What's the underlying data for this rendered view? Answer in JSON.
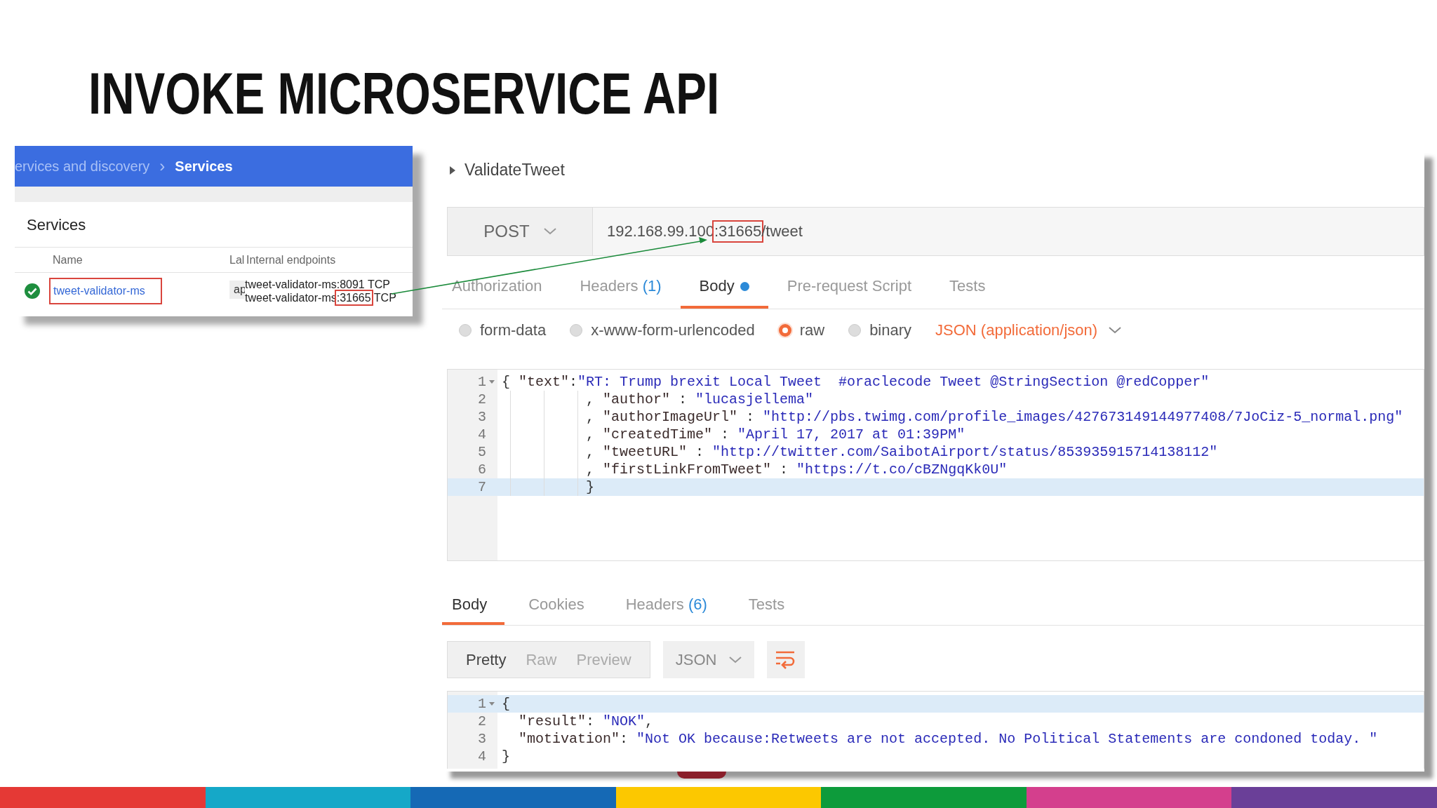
{
  "slide_title": "INVOKE MICROSERVICE API",
  "services_panel": {
    "breadcrumb": [
      {
        "label": "ervices and discovery",
        "current": false
      },
      {
        "label": "Services",
        "current": true
      }
    ],
    "separator": "›",
    "title": "Services",
    "columns": [
      {
        "label": "Name"
      },
      {
        "label": "Lal"
      },
      {
        "label": "Internal endpoints"
      }
    ],
    "rows": [
      {
        "healthy": true,
        "name": "tweet-validator-ms",
        "name_highlighted": true,
        "label_chip": "ap",
        "endpoints": [
          [
            {
              "text": "tweet-validator-ms:8091 TCP",
              "highlighted": false
            }
          ],
          [
            {
              "text": "tweet-validator-ms",
              "highlighted": false
            },
            {
              "text": ":31665",
              "highlighted": true
            },
            {
              "text": " TCP",
              "highlighted": false
            }
          ]
        ]
      }
    ]
  },
  "request": {
    "name": "ValidateTweet",
    "method": "POST",
    "url": [
      {
        "text": "192.168.99.100",
        "highlighted": false
      },
      {
        "text": ":31665",
        "highlighted": true
      },
      {
        "text": "/tweet",
        "highlighted": false
      }
    ],
    "tabs": [
      {
        "label": "Authorization",
        "dot": false,
        "selected": false
      },
      {
        "label": "Headers",
        "count": "(1)",
        "dot": false,
        "selected": false
      },
      {
        "label": "Body",
        "dot": true,
        "selected": true
      },
      {
        "label": "Pre-request Script",
        "dot": false,
        "selected": false
      },
      {
        "label": "Tests",
        "dot": false,
        "selected": false
      }
    ],
    "body_types": [
      {
        "kind": "radio",
        "label": "form-data",
        "selected": false
      },
      {
        "kind": "radio",
        "label": "x-www-form-urlencoded",
        "selected": false
      },
      {
        "kind": "radio",
        "label": "raw",
        "selected": true
      },
      {
        "kind": "radio",
        "label": "binary",
        "selected": false
      },
      {
        "kind": "dropdown",
        "label": "JSON (application/json)"
      }
    ],
    "code": [
      {
        "number": "1",
        "foldable": true,
        "kind": "top",
        "current": false,
        "tokens": [
          {
            "kind": "punct",
            "text": "{ "
          },
          {
            "kind": "key",
            "text": "\"text\""
          },
          {
            "kind": "punct",
            "text": ":"
          },
          {
            "kind": "string",
            "text": "\"RT: Trump brexit Local Tweet  #oraclecode Tweet @StringSection @redCopper\""
          }
        ]
      },
      {
        "number": "2",
        "foldable": false,
        "kind": "continuation",
        "current": false,
        "tokens": [
          {
            "kind": "punct",
            "text": ", "
          },
          {
            "kind": "key",
            "text": "\"author\""
          },
          {
            "kind": "punct",
            "text": " : "
          },
          {
            "kind": "string",
            "text": "\"lucasjellema\""
          }
        ]
      },
      {
        "number": "3",
        "foldable": false,
        "kind": "continuation",
        "current": false,
        "tokens": [
          {
            "kind": "punct",
            "text": ", "
          },
          {
            "kind": "key",
            "text": "\"authorImageUrl\""
          },
          {
            "kind": "punct",
            "text": " : "
          },
          {
            "kind": "string",
            "text": "\"http://pbs.twimg.com/profile_images/427673149144977408/7JoCiz-5_normal.png\""
          }
        ]
      },
      {
        "number": "4",
        "foldable": false,
        "kind": "continuation",
        "current": false,
        "tokens": [
          {
            "kind": "punct",
            "text": ", "
          },
          {
            "kind": "key",
            "text": "\"createdTime\""
          },
          {
            "kind": "punct",
            "text": " : "
          },
          {
            "kind": "string",
            "text": "\"April 17, 2017 at 01:39PM\""
          }
        ]
      },
      {
        "number": "5",
        "foldable": false,
        "kind": "continuation",
        "current": false,
        "tokens": [
          {
            "kind": "punct",
            "text": ", "
          },
          {
            "kind": "key",
            "text": "\"tweetURL\""
          },
          {
            "kind": "punct",
            "text": " : "
          },
          {
            "kind": "string",
            "text": "\"http://twitter.com/SaibotAirport/status/853935915714138112\""
          }
        ]
      },
      {
        "number": "6",
        "foldable": false,
        "kind": "continuation",
        "current": false,
        "tokens": [
          {
            "kind": "punct",
            "text": ", "
          },
          {
            "kind": "key",
            "text": "\"firstLinkFromTweet\""
          },
          {
            "kind": "punct",
            "text": " : "
          },
          {
            "kind": "string",
            "text": "\"https://t.co/cBZNgqKk0U\""
          }
        ]
      },
      {
        "number": "7",
        "foldable": false,
        "kind": "continuation",
        "current": true,
        "tokens": [
          {
            "kind": "punct",
            "text": "}"
          }
        ]
      }
    ]
  },
  "response": {
    "tabs": [
      {
        "label": "Body",
        "selected": true
      },
      {
        "label": "Cookies",
        "selected": false
      },
      {
        "label": "Headers",
        "count": "(6)",
        "selected": false
      },
      {
        "label": "Tests",
        "selected": false
      }
    ],
    "views": [
      {
        "label": "Pretty",
        "selected": true
      },
      {
        "label": "Raw",
        "selected": false
      },
      {
        "label": "Preview",
        "selected": false
      }
    ],
    "format": "JSON",
    "code": [
      {
        "number": "1",
        "foldable": true,
        "kind": "top",
        "current": true,
        "tokens": [
          {
            "kind": "punct",
            "text": "{"
          }
        ]
      },
      {
        "number": "2",
        "foldable": false,
        "kind": "nested",
        "current": false,
        "tokens": [
          {
            "kind": "key",
            "text": "\"result\""
          },
          {
            "kind": "punct",
            "text": ": "
          },
          {
            "kind": "string",
            "text": "\"NOK\""
          },
          {
            "kind": "punct",
            "text": ","
          }
        ]
      },
      {
        "number": "3",
        "foldable": false,
        "kind": "nested",
        "current": false,
        "tokens": [
          {
            "kind": "key",
            "text": "\"motivation\""
          },
          {
            "kind": "punct",
            "text": ": "
          },
          {
            "kind": "string",
            "text": "\"Not OK because:Retweets are not accepted. No Political Statements are condoned today. \""
          }
        ]
      },
      {
        "number": "4",
        "foldable": false,
        "kind": "top",
        "current": false,
        "tokens": [
          {
            "kind": "punct",
            "text": "}"
          }
        ]
      }
    ]
  }
}
